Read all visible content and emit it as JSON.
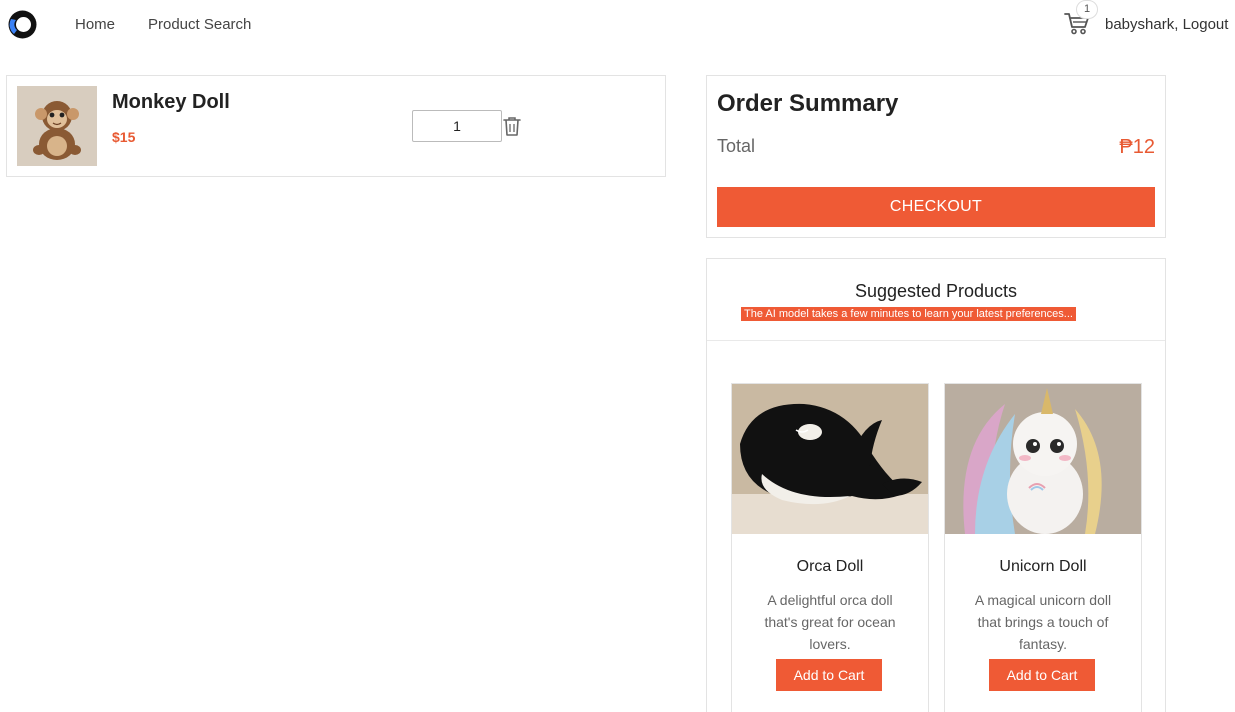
{
  "header": {
    "logo_icon": "logo-icon",
    "nav": [
      {
        "label": "Home"
      },
      {
        "label": "Product Search"
      }
    ],
    "cart_icon": "cart-icon",
    "cart_count": "1",
    "username": "babyshark",
    "logout_label": "Logout"
  },
  "cart": {
    "items": [
      {
        "name": "Monkey Doll",
        "price": "$15",
        "quantity": "1",
        "image": "monkey-doll-image",
        "delete_icon": "trash-icon"
      }
    ]
  },
  "summary": {
    "title": "Order Summary",
    "total_label": "Total",
    "total_value": "₱12",
    "checkout_label": "CHECKOUT"
  },
  "suggested": {
    "title": "Suggested Products",
    "note": "The AI model takes a few minutes to learn your latest preferences...",
    "products": [
      {
        "name": "Orca Doll",
        "description": "A delightful orca doll that's great for ocean lovers.",
        "button": "Add to Cart",
        "image": "orca-doll-image"
      },
      {
        "name": "Unicorn Doll",
        "description": "A magical unicorn doll that brings a touch of fantasy.",
        "button": "Add to Cart",
        "image": "unicorn-doll-image"
      }
    ]
  },
  "colors": {
    "accent": "#ef5a35",
    "price": "#e85a33"
  }
}
